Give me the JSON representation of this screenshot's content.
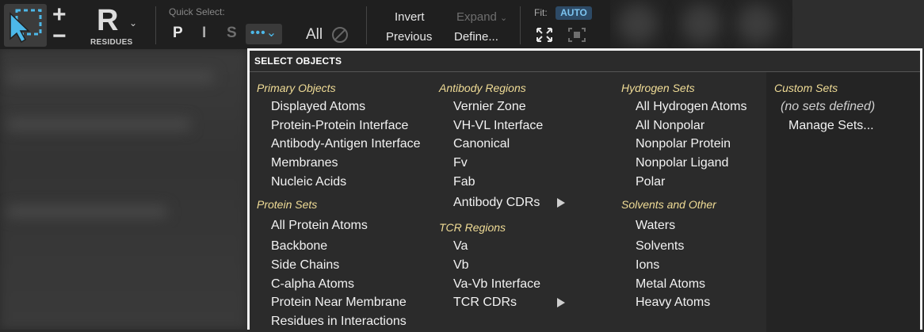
{
  "toolbar": {
    "residue_letter": "R",
    "residue_label": "RESIDUES",
    "chevron": "⌄",
    "quick_select_label": "Quick Select:",
    "qs_p": "P",
    "qs_i": "I",
    "qs_s": "S",
    "dots": "•••⌄",
    "all_label": "All",
    "invert_label": "Invert",
    "expand_label": "Expand",
    "expand_chevron": "⌄",
    "previous_label": "Previous",
    "define_label": "Define...",
    "fit_label": "Fit:",
    "auto_label": "AUTO",
    "colors": {
      "accent": "#4db8e8",
      "section": "#f0dc96",
      "disabled": "#6e6e6e"
    }
  },
  "menu": {
    "title": "SELECT OBJECTS",
    "columns": [
      {
        "sections": [
          {
            "title": "Primary Objects",
            "items": [
              "Displayed Atoms",
              "Protein-Protein Interface",
              "Antibody-Antigen Interface",
              "Membranes",
              "Nucleic Acids"
            ]
          },
          {
            "title": "Protein Sets",
            "items": [
              "All Protein Atoms",
              "Backbone",
              "Side Chains",
              "C-alpha Atoms",
              "Protein Near Membrane",
              "Residues in Interactions"
            ]
          }
        ]
      },
      {
        "sections": [
          {
            "title": "Antibody Regions",
            "items": [
              "Vernier Zone",
              "VH-VL Interface",
              "Canonical",
              "Fv",
              "Fab",
              "Antibody CDRs"
            ]
          },
          {
            "title": "TCR Regions",
            "items": [
              "Va",
              "Vb",
              "Va-Vb Interface",
              "TCR CDRs"
            ]
          }
        ]
      },
      {
        "sections": [
          {
            "title": "Hydrogen Sets",
            "items": [
              "All Hydrogen Atoms",
              "All Nonpolar",
              "Nonpolar Protein",
              "Nonpolar Ligand",
              "Polar"
            ]
          },
          {
            "title": "Solvents and Other",
            "items": [
              "Waters",
              "Solvents",
              "Ions",
              "Metal Atoms",
              "Heavy Atoms"
            ]
          }
        ]
      },
      {
        "sections": [
          {
            "title": "Custom Sets",
            "items": [
              "(no sets defined)",
              "Manage Sets..."
            ]
          }
        ]
      }
    ]
  }
}
